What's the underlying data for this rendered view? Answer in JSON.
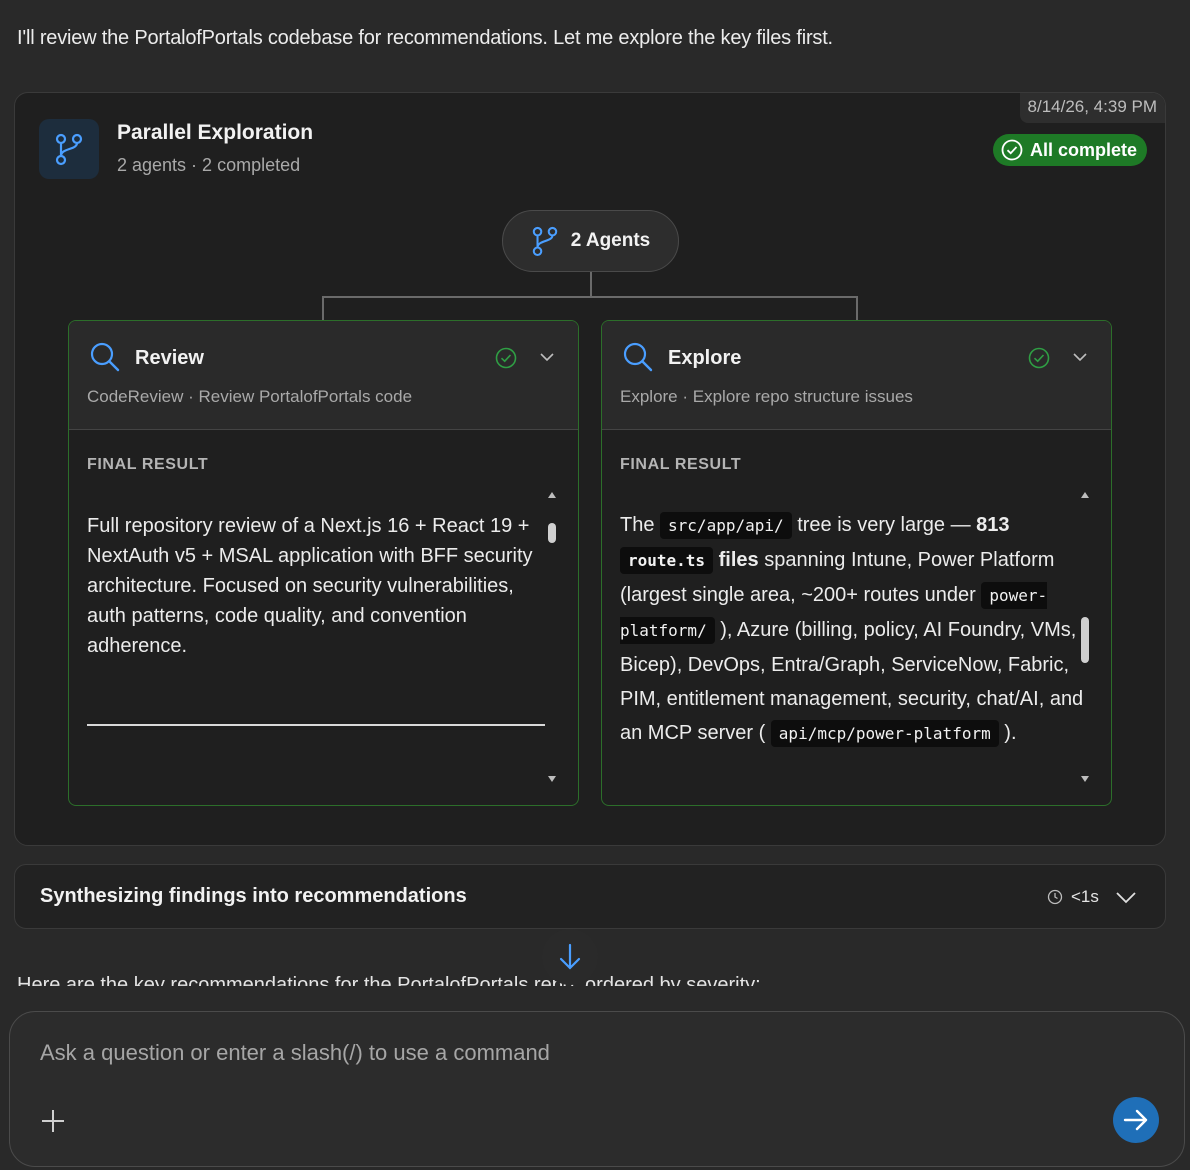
{
  "intro_text": "I'll review the PortalofPortals codebase for recommendations. Let me explore the key files first.",
  "exploration": {
    "timestamp": "8/14/26, 4:39 PM",
    "title": "Parallel Exploration",
    "subtitle": "2 agents · 2 completed",
    "status_badge": "All complete",
    "agents_pill": "2 Agents",
    "colors": {
      "success": "#1e7a26",
      "card_border": "#2c6e2a",
      "accent": "#4a9eff"
    },
    "cards": [
      {
        "title": "Review",
        "subtitle": "CodeReview · Review PortalofPortals code",
        "section_label": "FINAL RESULT",
        "body": "Full repository review of a Next.js 16 + React 19 + NextAuth v5 + MSAL application with BFF security architecture. Focused on security vulnerabilities, auth patterns, code quality, and convention adherence."
      },
      {
        "title": "Explore",
        "subtitle": "Explore · Explore repo structure issues",
        "section_label": "FINAL RESULT",
        "body_parts": {
          "t1": "The",
          "c1": "src/app/api/",
          "t2": "tree is very large —",
          "b1": "813",
          "c2": "route.ts",
          "b2": "files",
          "t3": "spanning Intune, Power Platform (largest single area, ~200+ routes under",
          "c3": "power-platform/",
          "t4": "), Azure (billing, policy, AI Foundry, VMs, Bicep), DevOps, Entra/Graph, ServiceNow, Fabric, PIM, entitlement management, security, chat/AI, and an MCP server (",
          "c4": "api/mcp/power-platform",
          "t5": ")."
        }
      }
    ]
  },
  "synthesis": {
    "label": "Synthesizing findings into recommendations",
    "duration": "<1s"
  },
  "followup_text": "Here are the key recommendations for the PortalofPortals repo, ordered by severity:",
  "composer": {
    "placeholder": "Ask a question or enter a slash(/) to use a command"
  },
  "icons": {
    "panel": "branch-icon",
    "pill": "branch-icon",
    "card": "search-icon",
    "check": "check-circle-icon",
    "expand": "chevron-down-icon",
    "clock": "clock-icon",
    "scroll": "arrow-down-icon",
    "add": "plus-icon",
    "send": "arrow-right-icon"
  }
}
